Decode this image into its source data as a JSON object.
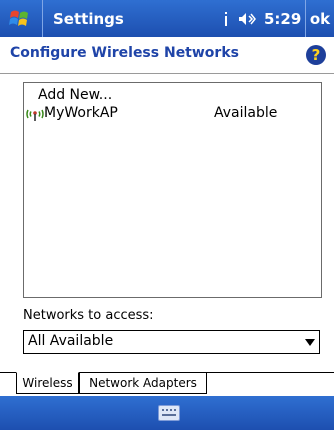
{
  "titlebar": {
    "title": "Settings",
    "time": "5:29",
    "ok_label": "ok",
    "icons": [
      "windows-start-icon",
      "signal-icon",
      "speaker-icon"
    ]
  },
  "header": {
    "title": "Configure Wireless Networks",
    "help_label": "?"
  },
  "network_list": {
    "add_new_label": "Add New...",
    "networks": [
      {
        "name": "MyWorkAP",
        "status": "Available",
        "icon": "wireless-antenna-icon"
      }
    ]
  },
  "access": {
    "label": "Networks to access:",
    "selected": "All Available"
  },
  "tabs": [
    {
      "label": "Wireless",
      "active": true
    },
    {
      "label": "Network Adapters",
      "active": false
    }
  ],
  "bottombar": {
    "icon": "keyboard-icon"
  },
  "colors": {
    "titlebar_bg": "#1d4fb0",
    "header_text": "#1f44a8",
    "help_icon_bg": "#1e3f9a",
    "help_icon_fg": "#ffd21e"
  }
}
